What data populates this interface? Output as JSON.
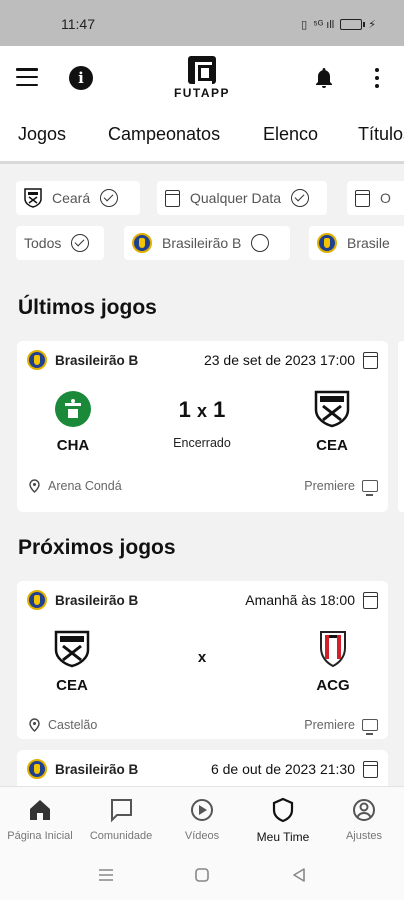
{
  "status_bar": {
    "time": "11:47",
    "signal_text": "⁵ᴳ ıll"
  },
  "header": {
    "logo_text": "FUTAPP"
  },
  "tabs": [
    {
      "label": "Jogos",
      "active": true
    },
    {
      "label": "Campeonatos",
      "active": false
    },
    {
      "label": "Elenco",
      "active": false
    },
    {
      "label": "Títulos",
      "active": false
    }
  ],
  "filters": {
    "team": {
      "label": "Ceará",
      "checked": true
    },
    "date": {
      "label": "Qualquer Data",
      "checked": true
    },
    "date_partial": {
      "label": "O"
    },
    "all": {
      "label": "Todos",
      "checked": true
    },
    "league": {
      "label": "Brasileirão B",
      "checked": false
    },
    "league_partial": {
      "label": "Brasile"
    }
  },
  "sections": {
    "last_games": "Últimos jogos",
    "next_games": "Próximos jogos"
  },
  "last_match": {
    "league": "Brasileirão B",
    "datetime": "23 de set de 2023 17:00",
    "home_code": "CHA",
    "away_code": "CEA",
    "score_home": "1",
    "score_sep": "x",
    "score_away": "1",
    "status": "Encerrado",
    "venue": "Arena Condá",
    "broadcast": "Premiere"
  },
  "next_match_1": {
    "league": "Brasileirão B",
    "datetime": "Amanhã às 18:00",
    "home_code": "CEA",
    "away_code": "ACG",
    "vs": "x",
    "venue": "Castelão",
    "broadcast": "Premiere"
  },
  "next_match_2": {
    "league": "Brasileirão B",
    "datetime": "6 de out de 2023 21:30"
  },
  "bottom_nav": [
    {
      "label": "Página Inicial",
      "icon": "home-icon"
    },
    {
      "label": "Comunidade",
      "icon": "chat-icon"
    },
    {
      "label": "Vídeos",
      "icon": "play-icon"
    },
    {
      "label": "Meu Time",
      "icon": "shield-icon",
      "active": true
    },
    {
      "label": "Ajustes",
      "icon": "user-circle-icon"
    }
  ],
  "colors": {
    "accent": "#111111",
    "background": "#f2f2f2",
    "chapecoense_green": "#1a8a3a",
    "atletico_red": "#d0202a"
  }
}
